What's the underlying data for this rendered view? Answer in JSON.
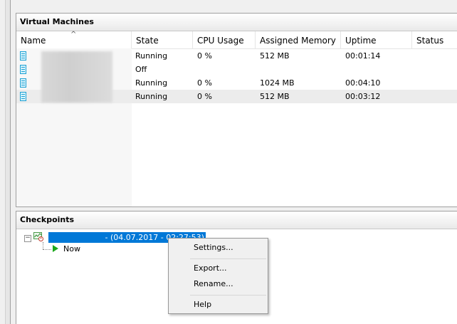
{
  "vm_pane": {
    "title": "Virtual Machines",
    "columns": [
      "Name",
      "State",
      "CPU Usage",
      "Assigned Memory",
      "Uptime",
      "Status"
    ],
    "sort_indicator": "^",
    "rows": [
      {
        "state": "Running",
        "cpu": "0 %",
        "memory": "512 MB",
        "uptime": "00:01:14"
      },
      {
        "state": "Off",
        "cpu": "",
        "memory": "",
        "uptime": ""
      },
      {
        "state": "Running",
        "cpu": "0 %",
        "memory": "1024 MB",
        "uptime": "00:04:10"
      },
      {
        "state": "Running",
        "cpu": "0 %",
        "memory": "512 MB",
        "uptime": "00:03:12"
      }
    ]
  },
  "checkpoints_pane": {
    "title": "Checkpoints",
    "checkpoint_suffix": " - (04.07.2017 - 02:27:53)",
    "now_label": "Now",
    "minus_glyph": "−"
  },
  "context_menu": {
    "items": [
      "Settings...",
      "Export...",
      "Rename...",
      "Help"
    ]
  },
  "colors": {
    "selection": "#0078d7",
    "vm_icon": "#1da1d4",
    "now_play": "#1ca81c"
  },
  "icons": {
    "vm": "vm-icon",
    "checkpoint": "checkpoint-icon",
    "now": "play-icon"
  }
}
